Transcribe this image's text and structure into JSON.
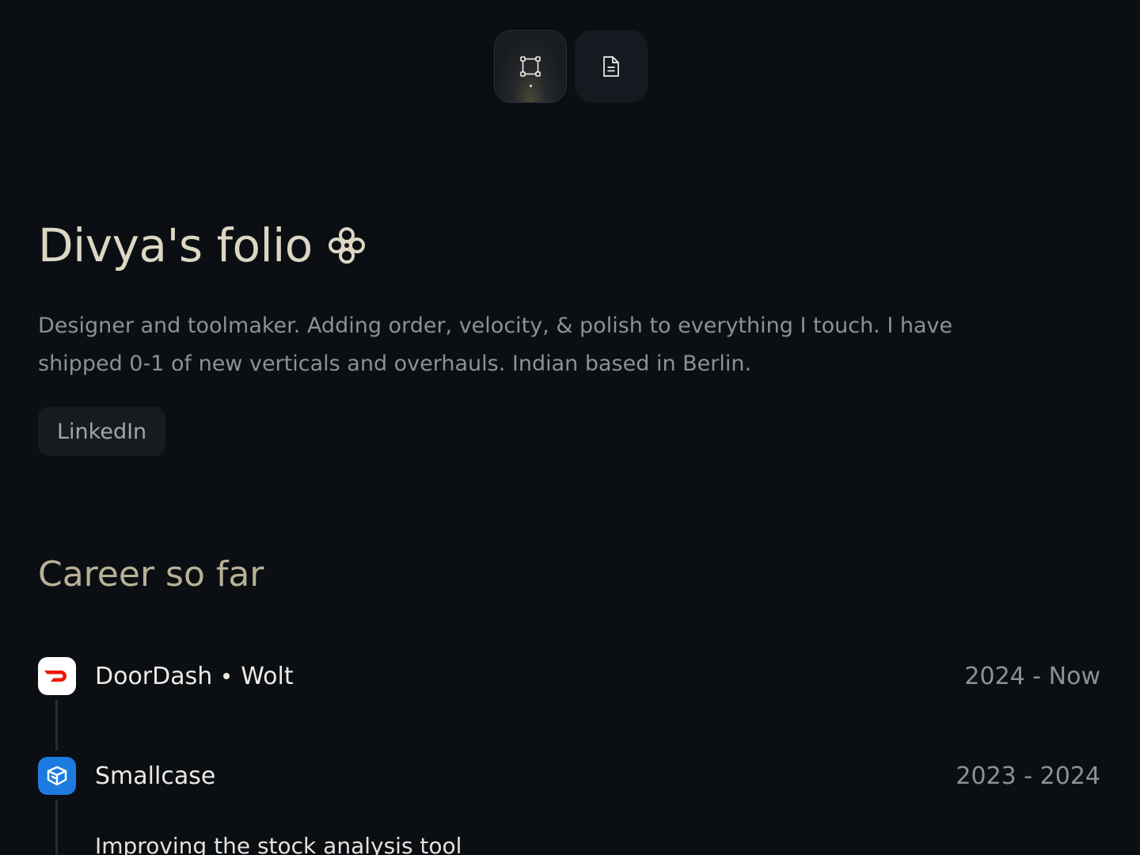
{
  "nav": {
    "items": [
      {
        "icon": "frame-icon",
        "active": true
      },
      {
        "icon": "document-icon",
        "active": false
      }
    ]
  },
  "hero": {
    "title": "Divya's folio",
    "title_icon": "flower-icon",
    "bio": "Designer and toolmaker. Adding order, velocity, & polish to everything I touch. I have shipped 0-1 of new verticals and overhauls. Indian based in Berlin.",
    "linkedin_label": "LinkedIn"
  },
  "career": {
    "title": "Career so far",
    "jobs": [
      {
        "company": "DoorDash",
        "company_secondary": "Wolt",
        "dates": "2024 - Now",
        "logo": "doordash-logo",
        "logo_color": "#eb1700"
      },
      {
        "company": "Smallcase",
        "dates": "2023 - 2024",
        "logo": "smallcase-logo",
        "logo_color": "#1d7be0",
        "project": "Improving the stock analysis tool"
      }
    ]
  },
  "colors": {
    "background": "#0b0f13",
    "title": "#dcd6c3",
    "section_title": "#b8b197",
    "muted_text": "#8d9194"
  }
}
